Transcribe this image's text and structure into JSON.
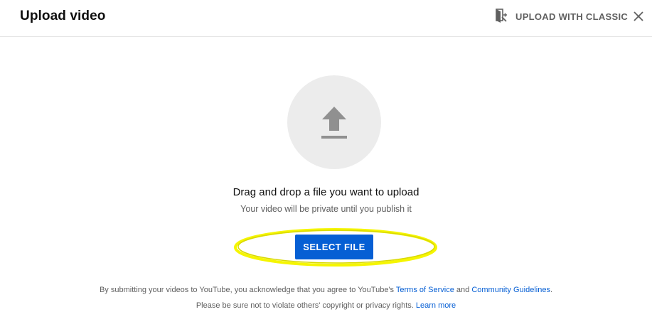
{
  "header": {
    "title": "Upload video",
    "classic_label": "UPLOAD WITH CLASSIC",
    "classic_icon": "classic-studio-icon",
    "close_icon": "close-icon"
  },
  "main": {
    "upload_icon": "upload-arrow-icon",
    "drag_text": "Drag and drop a file you want to upload",
    "private_text": "Your video will be private until you publish it",
    "select_button_label": "SELECT FILE",
    "highlight_color": "#f5f500",
    "button_color": "#065fd4"
  },
  "footer": {
    "line1_prefix": "By submitting your videos to YouTube, you acknowledge that you agree to YouTube's",
    "terms_link": "Terms of Service",
    "line1_and": "and",
    "guidelines_link": "Community Guidelines",
    "line1_suffix": ".",
    "line2_text": "Please be sure not to violate others' copyright or privacy rights.",
    "learn_more_link": "Learn more"
  }
}
